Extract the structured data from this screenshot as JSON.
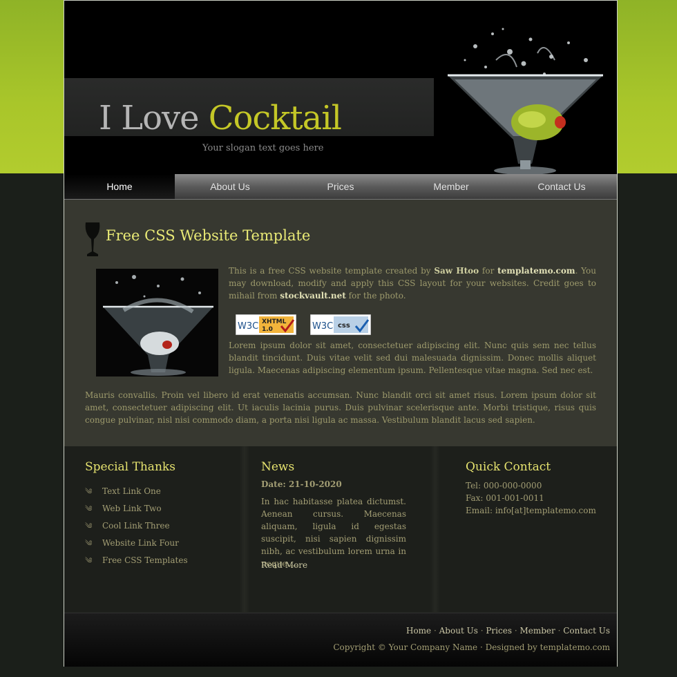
{
  "site": {
    "logo_part1": "I Love",
    "logo_part2": "Cocktail",
    "slogan": "Your slogan text goes here"
  },
  "menu": {
    "items": [
      {
        "label": "Home"
      },
      {
        "label": "About Us"
      },
      {
        "label": "Prices"
      },
      {
        "label": "Member"
      },
      {
        "label": "Contact Us"
      }
    ]
  },
  "main": {
    "title": "Free CSS Website Template",
    "intro_1": "This is a free CSS website template created by",
    "intro_author": "Saw Htoo",
    "intro_2": "for",
    "intro_site": "templatemo.com",
    "intro_3": ". You may download, modify and apply this CSS layout for your websites. Credit goes to mihail from",
    "intro_credit": "stockvault.net",
    "intro_4": "for the photo.",
    "badge_xhtml_a": "W3C",
    "badge_xhtml_b": "XHTML",
    "badge_xhtml_c": "1.0",
    "badge_css_a": "W3C",
    "badge_css_b": "css",
    "para_2": "Lorem ipsum dolor sit amet, consectetuer adipiscing elit. Nunc quis sem nec tellus blandit tincidunt. Duis vitae velit sed dui malesuada dignissim. Donec mollis aliquet ligula. Maecenas adipiscing elementum ipsum. Pellentesque vitae magna. Sed nec est.",
    "para_3": "Mauris convallis. Proin vel libero id erat venenatis accumsan. Nunc blandit orci sit amet risus. Lorem ipsum dolor sit amet, consectetuer adipiscing elit. Ut iaculis lacinia purus. Duis pulvinar scelerisque ante. Morbi tristique, risus quis congue pulvinar, nisl nisi commodo diam, a porta nisi ligula ac massa. Vestibulum blandit lacus sed sapien."
  },
  "thanks": {
    "title": "Special Thanks",
    "links": [
      "Text Link One",
      "Web Link Two",
      "Cool Link Three",
      "Website Link Four",
      "Free CSS Templates"
    ]
  },
  "news": {
    "title": "News",
    "date": "Date: 21-10-2020",
    "text": "In hac habitasse platea dictumst. Aenean cursus. Maecenas aliquam, ligula id egestas suscipit, nisi sapien dignissim nibh, ac vestibulum lorem urna in neque....",
    "read_more": "Read More"
  },
  "contact": {
    "title": "Quick Contact",
    "tel": "Tel: 000-000-0000",
    "fax": "Fax: 001-001-0011",
    "email": "Email: info[at]templatemo.com"
  },
  "footer": {
    "links": [
      "Home",
      "About Us",
      "Prices",
      "Member",
      "Contact Us"
    ],
    "separator": "·",
    "copyright": "Copyright © Your Company Name · Designed by templatemo.com"
  },
  "colors": {
    "accent": "#c4c727",
    "heading": "#e9ea76",
    "page_top": "#a9c62a"
  }
}
